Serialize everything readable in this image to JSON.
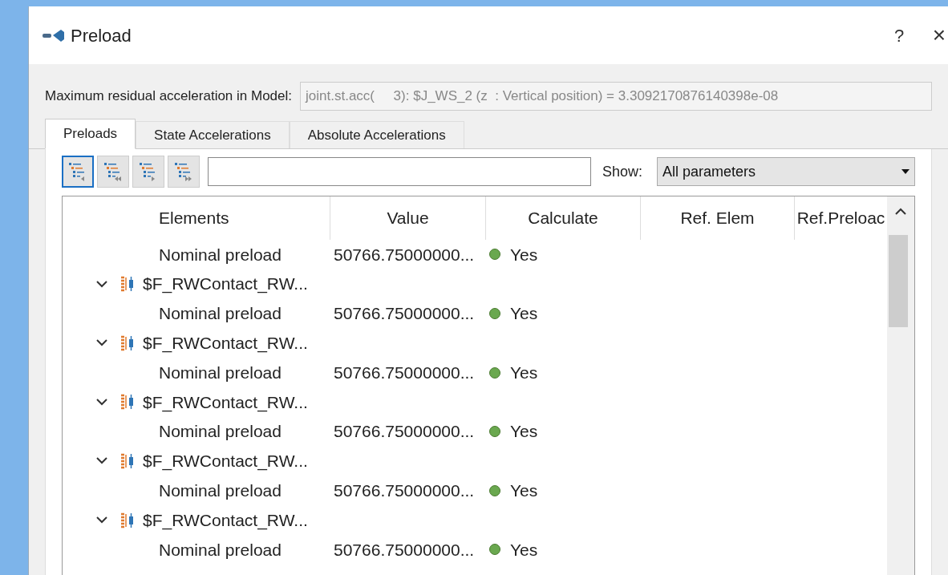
{
  "window": {
    "title": "Preload",
    "help": "?",
    "close": "×"
  },
  "residual": {
    "label": "Maximum residual acceleration in Model:",
    "value": "joint.st.acc(     3): $J_WS_2 (z  : Vertical position) = 3.3092170876140398e-08"
  },
  "tabs": [
    {
      "label": "Preloads",
      "selected": true
    },
    {
      "label": "State Accelerations",
      "selected": false
    },
    {
      "label": "Absolute Accelerations",
      "selected": false
    }
  ],
  "toolbar": {
    "buttons": [
      {
        "kind": "collapse",
        "selected": true
      },
      {
        "kind": "collapse_all",
        "selected": false
      },
      {
        "kind": "expand",
        "selected": false
      },
      {
        "kind": "expand_all",
        "selected": false
      }
    ],
    "show_label": "Show:",
    "show_value": "All parameters"
  },
  "table": {
    "columns": [
      "Elements",
      "Value",
      "Calculate",
      "Ref. Elem",
      "Ref.Preloac"
    ],
    "rows": [
      {
        "kind": "parameter",
        "label": "Nominal preload",
        "value": "50766.75000000...",
        "calculate": "Yes",
        "color": "#6aa84f"
      },
      {
        "kind": "group",
        "label": "$F_RWContact_RW...",
        "expanded": true,
        "children": [
          {
            "kind": "parameter",
            "label": "Nominal preload",
            "value": "50766.75000000...",
            "calculate": "Yes",
            "color": "#6aa84f"
          }
        ]
      },
      {
        "kind": "group",
        "label": "$F_RWContact_RW...",
        "expanded": true,
        "children": [
          {
            "kind": "parameter",
            "label": "Nominal preload",
            "value": "50766.75000000...",
            "calculate": "Yes",
            "color": "#6aa84f"
          }
        ]
      },
      {
        "kind": "group",
        "label": "$F_RWContact_RW...",
        "expanded": true,
        "children": [
          {
            "kind": "parameter",
            "label": "Nominal preload",
            "value": "50766.75000000...",
            "calculate": "Yes",
            "color": "#6aa84f"
          }
        ]
      },
      {
        "kind": "group",
        "label": "$F_RWContact_RW...",
        "expanded": true,
        "children": [
          {
            "kind": "parameter",
            "label": "Nominal preload",
            "value": "50766.75000000...",
            "calculate": "Yes",
            "color": "#6aa84f"
          }
        ]
      },
      {
        "kind": "group",
        "label": "$F_RWContact_RW...",
        "expanded": true,
        "children": [
          {
            "kind": "parameter",
            "label": "Nominal preload",
            "value": "50766.75000000...",
            "calculate": "Yes",
            "color": "#6aa84f"
          }
        ]
      }
    ]
  }
}
